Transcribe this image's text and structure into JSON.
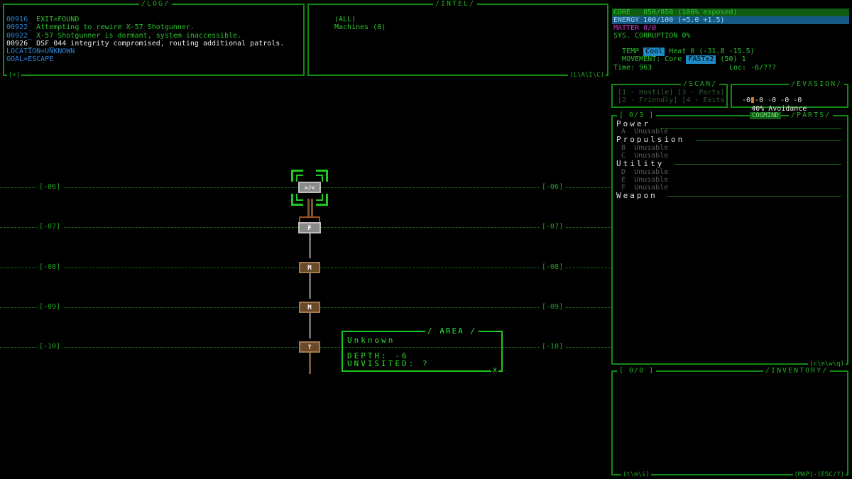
{
  "log": {
    "title": "/LOG/",
    "footer_left": "[+]",
    "lines": [
      {
        "ts": "00916_",
        "text": " EXIT=FOUND",
        "color": "green"
      },
      {
        "ts": "00922_",
        "text": " Attempting to rewire X-57 Shotgunner.",
        "color": "green"
      },
      {
        "ts": "00922_",
        "text": " X-57 Shotgunner is dormant, system inaccessible.",
        "color": "green"
      },
      {
        "ts": "00926_",
        "text": " DSF_044 integrity compromised, routing additional patrols.",
        "color": "white"
      },
      {
        "ts": "",
        "text": "LOCATION=UNKNOWN",
        "color": "blue"
      },
      {
        "ts": "",
        "text": "GOAL=ESCAPE",
        "color": "blue"
      }
    ]
  },
  "intel": {
    "title": "/INTEL/",
    "footer_right": "(L\\A\\I\\C)",
    "items": [
      "(ALL)",
      "Machines (0)"
    ]
  },
  "status": {
    "core": "CORE   850/850 (100% exposed)",
    "energy": "ENERGY 100/100 (+5.0 +1.5)",
    "matter": "MATTER 0/0",
    "corruption": "SYS. CORRUPTION 0%",
    "temp_label": "TEMP ",
    "temp_tag": "Cool",
    "temp_value": " Heat 0 (-31.8 -15.5)",
    "movement_label": "MOVEMENT: Core ",
    "movement_tag": "FASTx2",
    "movement_value": " (50) 1",
    "time": "Time: 963",
    "loc": "Loc: -6/???"
  },
  "scan": {
    "title": "/SCAN/",
    "row1": "[1 - Hostile] [3 - Parts]",
    "row2": "[2 - Friendly] [4 - Exits]"
  },
  "evasion": {
    "title": "/EVASION/",
    "avoidance": "40% Avoidance",
    "values": "-0 -0 -0 -0 -0"
  },
  "parts": {
    "title": "/PARTS/",
    "count": "[ 0/3 ]",
    "badge": "COGMIND",
    "footer": "(c\\e\\w\\q)",
    "sections": [
      {
        "name": "Power",
        "slots": [
          {
            "key": "A",
            "label": "Unusable"
          }
        ]
      },
      {
        "name": "Propulsion",
        "slots": [
          {
            "key": "B",
            "label": "Unusable"
          },
          {
            "key": "C",
            "label": "Unusable"
          }
        ]
      },
      {
        "name": "Utility",
        "slots": [
          {
            "key": "D",
            "label": "Unusable"
          },
          {
            "key": "E",
            "label": "Unusable"
          },
          {
            "key": "F",
            "label": "Unusable"
          }
        ]
      },
      {
        "name": "Weapon",
        "slots": []
      }
    ]
  },
  "inventory": {
    "title": "/INVENTORY/",
    "count": "[ 0/0 ]",
    "footer_left": "(t\\m\\i)",
    "footer_right": "(MAP)-(ESC/?)"
  },
  "map": {
    "depths": [
      "[-06]",
      "[-07]",
      "[-08]",
      "[-09]",
      "[-10]"
    ],
    "nodes": [
      {
        "glyph": ">/<",
        "style": "gray"
      },
      {
        "glyph": "F",
        "style": "gray"
      },
      {
        "glyph": "M",
        "style": "brown"
      },
      {
        "glyph": "M",
        "style": "brown"
      },
      {
        "glyph": "?",
        "style": "brown"
      }
    ]
  },
  "area": {
    "title": "/ AREA /",
    "name": "Unknown",
    "depth": "DEPTH: -6",
    "unvisited": "UNVISITED: ?",
    "close": "X"
  },
  "colors": {
    "bg": "#000000",
    "border": "#118a11",
    "core_bar": "#0f5d12",
    "energy_bar": "#155b86",
    "tag": "#1f89c5"
  }
}
